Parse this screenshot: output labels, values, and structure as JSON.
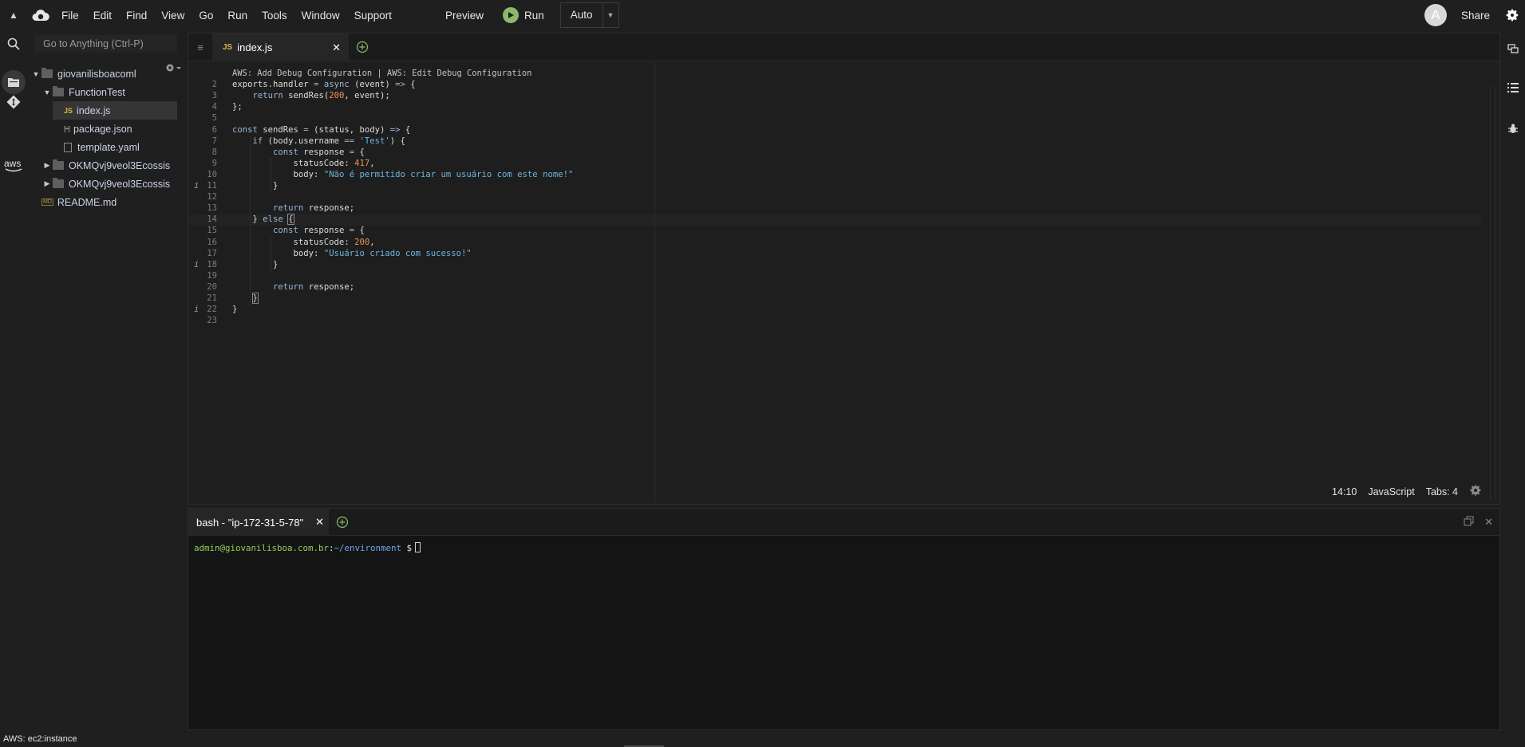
{
  "menubar": {
    "items": [
      "File",
      "Edit",
      "Find",
      "View",
      "Go",
      "Run",
      "Tools",
      "Window",
      "Support"
    ],
    "preview_label": "Preview",
    "run_label": "Run",
    "run_mode": "Auto",
    "avatar_initial": "A",
    "share_label": "Share"
  },
  "sidebar": {
    "goto_placeholder": "Go to Anything (Ctrl-P)",
    "tree": [
      {
        "label": "giovanilisboacoml",
        "type": "folder",
        "depth": 0,
        "expanded": true
      },
      {
        "label": "FunctionTest",
        "type": "folder",
        "depth": 1,
        "expanded": true
      },
      {
        "label": "index.js",
        "type": "js",
        "depth": 2,
        "selected": true
      },
      {
        "label": "package.json",
        "type": "json",
        "depth": 2
      },
      {
        "label": "template.yaml",
        "type": "yaml",
        "depth": 2
      },
      {
        "label": "OKMQvj9veol3Ecossis",
        "type": "folder",
        "depth": 1,
        "expanded": false
      },
      {
        "label": "OKMQvj9veol3Ecossis",
        "type": "folder",
        "depth": 1,
        "expanded": false
      },
      {
        "label": "README.md",
        "type": "md",
        "depth": 1
      }
    ]
  },
  "editor": {
    "tab_label": "index.js",
    "tab_icon_text": "JS",
    "codelens": "AWS: Add Debug Configuration | AWS: Edit Debug Configuration",
    "lines": [
      {
        "n": "2",
        "info": false,
        "tokens": [
          [
            "t",
            "exports.handler "
          ],
          [
            "o",
            "="
          ],
          [
            "t",
            " "
          ],
          [
            "k",
            "async"
          ],
          [
            "t",
            " (event) "
          ],
          [
            "o",
            "=>"
          ],
          [
            "t",
            " {"
          ]
        ]
      },
      {
        "n": "3",
        "info": false,
        "tokens": [
          [
            "t",
            "    "
          ],
          [
            "k",
            "return"
          ],
          [
            "t",
            " sendRes("
          ],
          [
            "n",
            "200"
          ],
          [
            "t",
            ", event);"
          ]
        ]
      },
      {
        "n": "4",
        "info": false,
        "tokens": [
          [
            "t",
            "};"
          ]
        ]
      },
      {
        "n": "5",
        "info": false,
        "tokens": []
      },
      {
        "n": "6",
        "info": false,
        "tokens": [
          [
            "k",
            "const"
          ],
          [
            "t",
            " sendRes "
          ],
          [
            "o",
            "="
          ],
          [
            "t",
            " (status, body) "
          ],
          [
            "o",
            "=>"
          ],
          [
            "t",
            " {"
          ]
        ]
      },
      {
        "n": "7",
        "info": false,
        "tokens": [
          [
            "t",
            "    "
          ],
          [
            "k",
            "if"
          ],
          [
            "t",
            " (body.username "
          ],
          [
            "o",
            "=="
          ],
          [
            "t",
            " "
          ],
          [
            "s",
            "'Test'"
          ],
          [
            "t",
            ") {"
          ]
        ]
      },
      {
        "n": "8",
        "info": false,
        "tokens": [
          [
            "t",
            "        "
          ],
          [
            "k",
            "const"
          ],
          [
            "t",
            " response "
          ],
          [
            "o",
            "="
          ],
          [
            "t",
            " {"
          ]
        ]
      },
      {
        "n": "9",
        "info": false,
        "tokens": [
          [
            "t",
            "            statusCode: "
          ],
          [
            "n",
            "417"
          ],
          [
            "t",
            ","
          ]
        ]
      },
      {
        "n": "10",
        "info": false,
        "tokens": [
          [
            "t",
            "            body: "
          ],
          [
            "s",
            "\"Não é permitido criar um usuário com este nome!\""
          ]
        ]
      },
      {
        "n": "11",
        "info": true,
        "tokens": [
          [
            "t",
            "        }"
          ]
        ]
      },
      {
        "n": "12",
        "info": false,
        "tokens": []
      },
      {
        "n": "13",
        "info": false,
        "tokens": [
          [
            "t",
            "        "
          ],
          [
            "k",
            "return"
          ],
          [
            "t",
            " response;"
          ]
        ]
      },
      {
        "n": "14",
        "info": false,
        "current": true,
        "tokens": [
          [
            "t",
            "    } "
          ],
          [
            "k",
            "else"
          ],
          [
            "t",
            " "
          ],
          [
            "b",
            "{"
          ]
        ]
      },
      {
        "n": "15",
        "info": false,
        "tokens": [
          [
            "t",
            "        "
          ],
          [
            "k",
            "const"
          ],
          [
            "t",
            " response "
          ],
          [
            "o",
            "="
          ],
          [
            "t",
            " {"
          ]
        ]
      },
      {
        "n": "16",
        "info": false,
        "tokens": [
          [
            "t",
            "            statusCode: "
          ],
          [
            "n",
            "200"
          ],
          [
            "t",
            ","
          ]
        ]
      },
      {
        "n": "17",
        "info": false,
        "tokens": [
          [
            "t",
            "            body: "
          ],
          [
            "s",
            "\"Usuário criado com sucesso!\""
          ]
        ]
      },
      {
        "n": "18",
        "info": true,
        "tokens": [
          [
            "t",
            "        }"
          ]
        ]
      },
      {
        "n": "19",
        "info": false,
        "tokens": []
      },
      {
        "n": "20",
        "info": false,
        "tokens": [
          [
            "t",
            "        "
          ],
          [
            "k",
            "return"
          ],
          [
            "t",
            " response;"
          ]
        ]
      },
      {
        "n": "21",
        "info": false,
        "tokens": [
          [
            "t",
            "    "
          ],
          [
            "b",
            "}"
          ]
        ]
      },
      {
        "n": "22",
        "info": true,
        "tokens": [
          [
            "t",
            "}"
          ]
        ]
      },
      {
        "n": "23",
        "info": false,
        "tokens": []
      }
    ],
    "status": {
      "position": "14:10",
      "language": "JavaScript",
      "tabs": "Tabs: 4"
    }
  },
  "terminal": {
    "tab_label": "bash - \"ip-172-31-5-78\"",
    "prompt_user": "admin@giovanilisboa.com.br",
    "prompt_sep": ":",
    "prompt_path": "~/environment",
    "prompt_dollar": " $"
  },
  "status_bar": {
    "text": "AWS: ec2:instance"
  },
  "colors": {
    "accent_run": "#8bb86b",
    "keyword": "#9ab6d8",
    "number": "#e8935a",
    "string": "#6fb4e0",
    "prompt_user": "#8fcf5a",
    "prompt_path": "#6fa6e6"
  }
}
